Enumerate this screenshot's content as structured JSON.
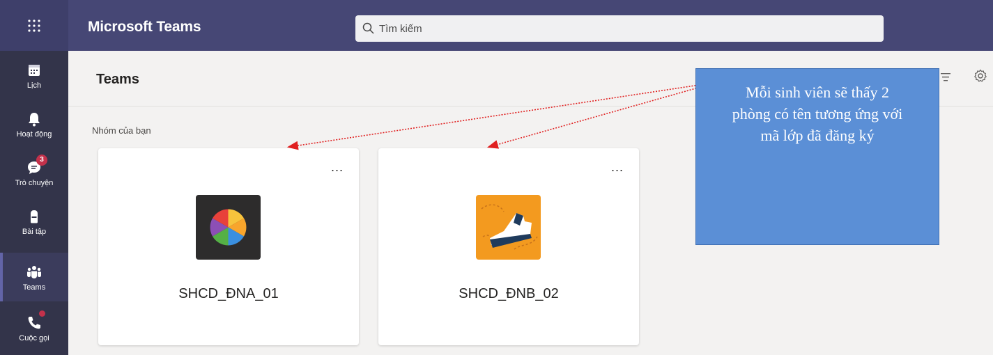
{
  "app": {
    "title": "Microsoft Teams"
  },
  "search": {
    "placeholder": "Tìm kiếm"
  },
  "rail": {
    "items": [
      {
        "label": "Lịch",
        "icon": "calendar-icon"
      },
      {
        "label": "Hoạt động",
        "icon": "bell-icon"
      },
      {
        "label": "Trò chuyện",
        "icon": "chat-icon",
        "badge": "3"
      },
      {
        "label": "Bài tập",
        "icon": "backpack-icon"
      },
      {
        "label": "Teams",
        "icon": "teams-icon",
        "active": true
      },
      {
        "label": "Cuộc gọi",
        "icon": "phone-icon",
        "dot": true
      }
    ]
  },
  "header": {
    "title": "Teams"
  },
  "section": {
    "label": "Nhóm của bạn"
  },
  "teams": [
    {
      "name": "SHCD_ĐNA_01",
      "more": "...",
      "logo": "color-wheel-logo"
    },
    {
      "name": "SHCD_ĐNB_02",
      "more": "...",
      "logo": "sneaker-logo"
    }
  ],
  "callout": {
    "text": "Mỗi sinh viên sẽ thấy 2 phòng có tên tương ứng với mã lớp đã đăng ký"
  },
  "colors": {
    "topbar": "#464775",
    "rail": "#33344a",
    "accent": "#6264a7",
    "callout": "#5b8fd6",
    "arrow": "#e02020"
  }
}
